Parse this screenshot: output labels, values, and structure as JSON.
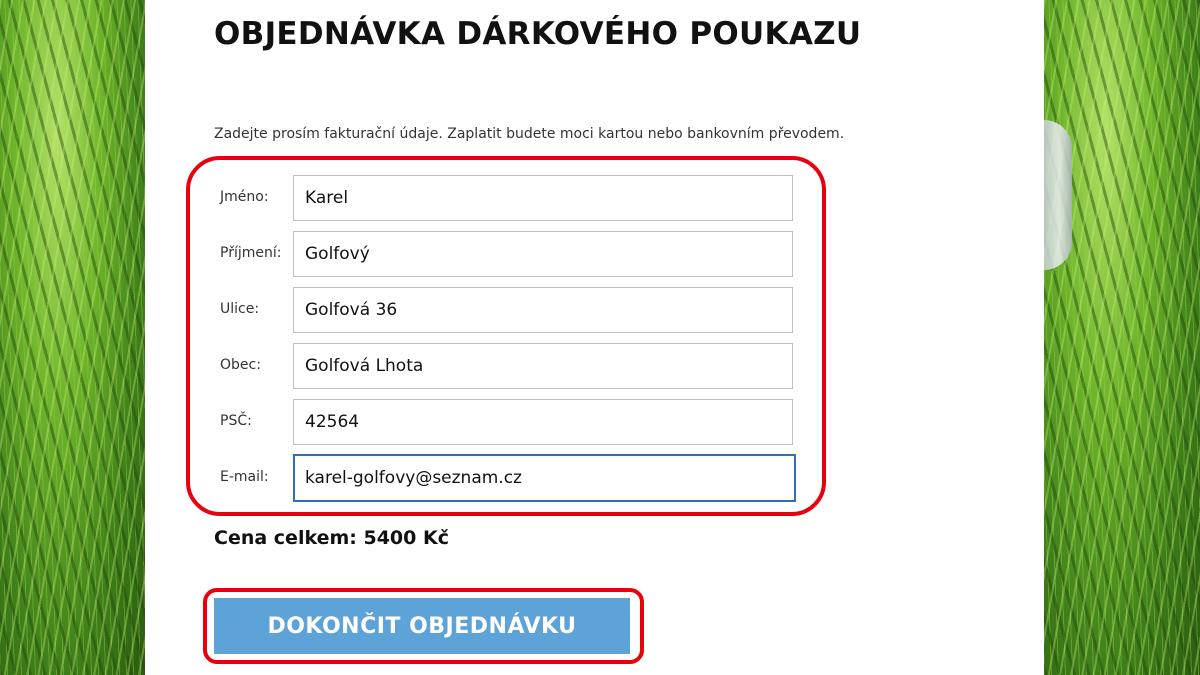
{
  "page": {
    "title": "OBJEDNÁVKA DÁRKOVÉHO POUKAZU",
    "intro": "Zadejte prosím fakturační údaje. Zaplatit budete moci kartou nebo bankovním převodem."
  },
  "form": {
    "fields": [
      {
        "label": "Jméno:",
        "value": "Karel"
      },
      {
        "label": "Příjmení:",
        "value": "Golfový"
      },
      {
        "label": "Ulice:",
        "value": "Golfová 36"
      },
      {
        "label": "Obec:",
        "value": "Golfová Lhota"
      },
      {
        "label": "PSČ:",
        "value": "42564"
      },
      {
        "label": "E-mail:",
        "value": "karel-golfovy@seznam.cz"
      }
    ]
  },
  "summary": {
    "total": "Cena celkem: 5400 Kč"
  },
  "actions": {
    "submit_label": "DOKONČIT OBJEDNÁVKU"
  },
  "colors": {
    "highlight": "#e8000d",
    "button": "#5ea3d8",
    "focus": "#2f6fb6"
  }
}
